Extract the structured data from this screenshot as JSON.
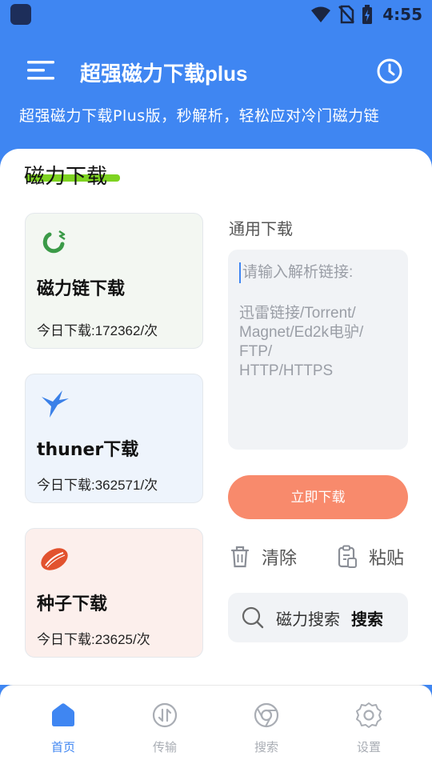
{
  "status_bar": {
    "time": "4:55"
  },
  "app_bar": {
    "title": "超强磁力下载plus"
  },
  "subtitle": "超强磁力下载Plus版，秒解析，轻松应对冷门磁力链",
  "section": {
    "title": "磁力下载"
  },
  "cards": [
    {
      "title": "磁力链下载",
      "count": "今日下载:172362/次",
      "icon": "magnet-icon"
    },
    {
      "title": "thuner下载",
      "count": "今日下载:362571/次",
      "icon": "bird-icon"
    },
    {
      "title": "种子下载",
      "count": "今日下载:23625/次",
      "icon": "seed-icon"
    }
  ],
  "general": {
    "label": "通用下载",
    "placeholder_title": "请输入解析链接:",
    "placeholder_lines": [
      "迅雷链接/Torrent/",
      "Magnet/Ed2k电驴/",
      "FTP/",
      "HTTP/HTTPS"
    ],
    "download_button": "立即下载",
    "clear_label": "清除",
    "paste_label": "粘贴"
  },
  "search": {
    "text": "磁力搜索",
    "button": "搜索"
  },
  "bottom_nav": [
    {
      "label": "首页",
      "icon": "home-icon",
      "active": true
    },
    {
      "label": "传输",
      "icon": "transfer-icon",
      "active": false
    },
    {
      "label": "搜索",
      "icon": "browser-icon",
      "active": false
    },
    {
      "label": "设置",
      "icon": "gear-icon",
      "active": false
    }
  ],
  "colors": {
    "primary": "#3f86f2",
    "accent_green": "#7ed321",
    "download_button": "#f88a6c",
    "magnet_card": "#f3f7f2",
    "thuner_card": "#eef4fc",
    "seed_card": "#fcefec"
  }
}
